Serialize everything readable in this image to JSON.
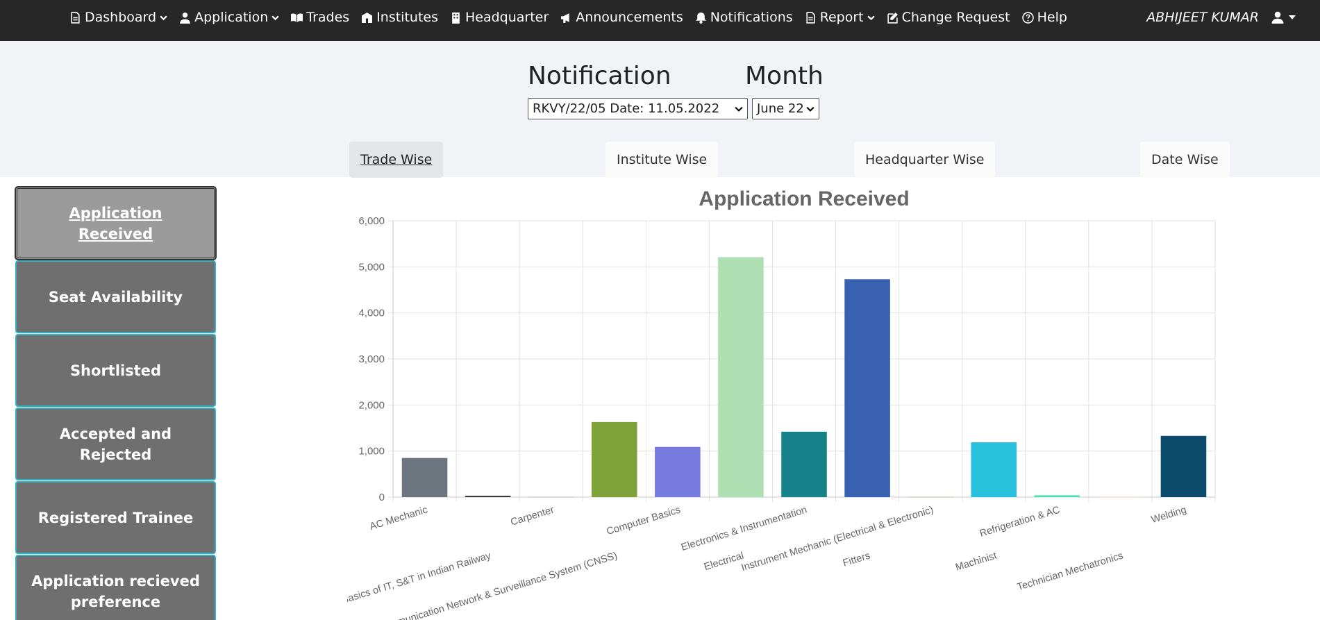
{
  "navbar": {
    "items": [
      {
        "label": "Dashboard",
        "icon": "file-icon",
        "dropdown": true
      },
      {
        "label": "Application",
        "icon": "user-tie-icon",
        "dropdown": true
      },
      {
        "label": "Trades",
        "icon": "book-open-icon",
        "dropdown": false
      },
      {
        "label": "Institutes",
        "icon": "school-icon",
        "dropdown": false
      },
      {
        "label": "Headquarter",
        "icon": "building-icon",
        "dropdown": false
      },
      {
        "label": "Announcements",
        "icon": "megaphone-icon",
        "dropdown": false
      },
      {
        "label": "Notifications",
        "icon": "bell-icon",
        "dropdown": false
      },
      {
        "label": "Report",
        "icon": "file-icon",
        "dropdown": true
      },
      {
        "label": "Change Request",
        "icon": "edit-icon",
        "dropdown": false
      },
      {
        "label": "Help",
        "icon": "question-circle-icon",
        "dropdown": false
      }
    ],
    "user_name": "ABHIJEET KUMAR"
  },
  "filters": {
    "notification_label": "Notification",
    "month_label": "Month",
    "notification_value": "RKVY/22/05 Date: 11.05.2022",
    "month_value": "June 22"
  },
  "tabs": [
    "Trade Wise",
    "Institute Wise",
    "Headquarter Wise",
    "Date Wise"
  ],
  "active_tab": "Trade Wise",
  "sidebar": {
    "items": [
      "Application Received",
      "Seat Availability",
      "Shortlisted",
      "Accepted and Rejected",
      "Registered Trainee",
      "Application recieved preference"
    ],
    "active": "Application Received"
  },
  "chart_data": {
    "type": "bar",
    "title": "Application Received",
    "xlabel": "",
    "ylabel": "",
    "ylim": [
      0,
      6000
    ],
    "yticks": [
      "0",
      "1,000",
      "2,000",
      "3,000",
      "4,000",
      "5,000",
      "6,000"
    ],
    "grid": true,
    "legend": "none",
    "categories": [
      "AC Mechanic",
      "Basics of IT, S&T in Indian Railway",
      "Carpenter",
      "Communication Network & Surveillance System (CNSS)",
      "Computer Basics",
      "Electrical",
      "Electronics & Instrumentation",
      "Fitters",
      "Instrument Mechanic (Electrical & Electronic)",
      "Machinist",
      "Refrigeration & AC",
      "Technician Mechatronics",
      "Welding"
    ],
    "values": [
      850,
      30,
      5,
      1630,
      1090,
      5210,
      1420,
      4730,
      5,
      1190,
      40,
      5,
      1330
    ],
    "colors": [
      "#6c757d",
      "#343a40",
      "#adb5bd",
      "#7fa33a",
      "#787be0",
      "#addfb2",
      "#16828a",
      "#3862b0",
      "#b9b09a",
      "#28c0dc",
      "#50e3b8",
      "#e7d8b0",
      "#0b4a6b"
    ]
  }
}
